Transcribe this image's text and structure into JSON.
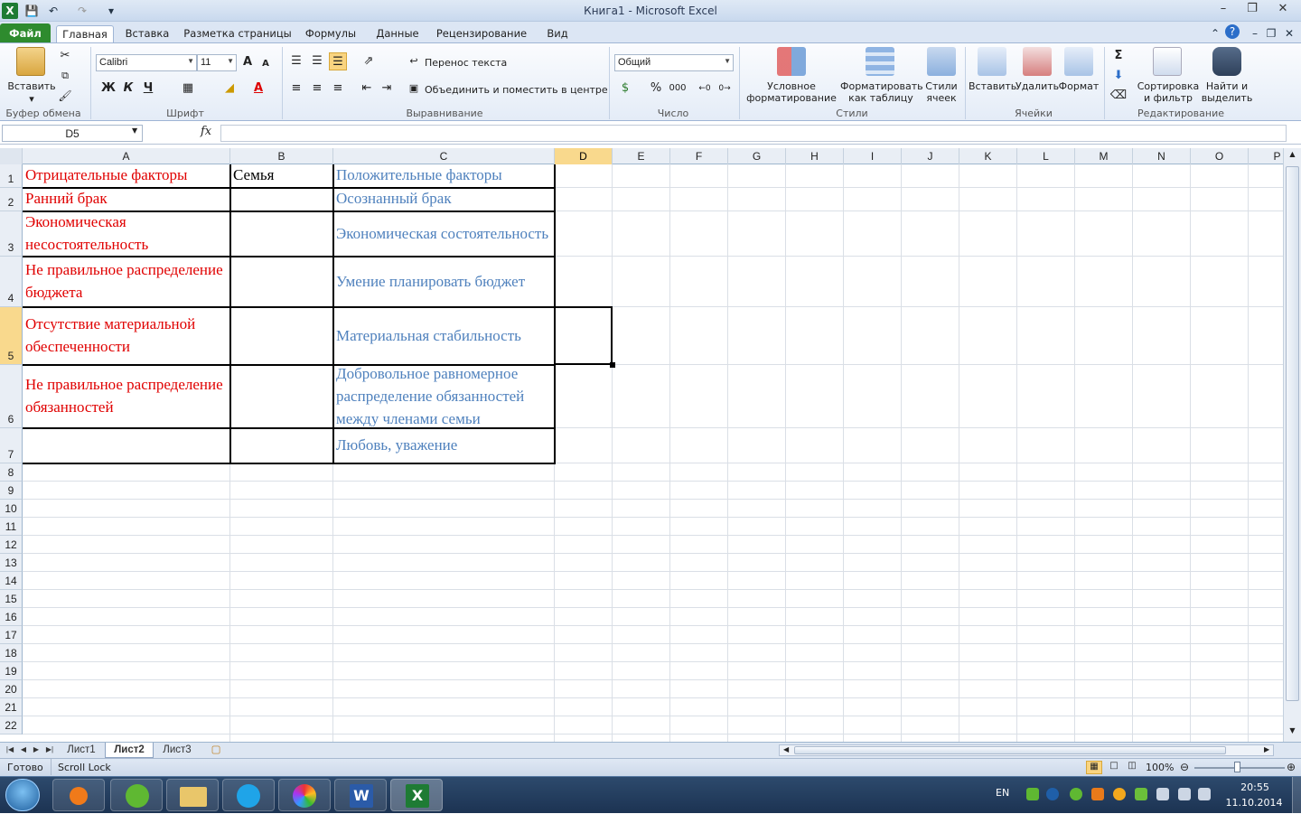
{
  "window": {
    "title": "Книга1  -  Microsoft Excel"
  },
  "ribbon_tabs": [
    "Файл",
    "Главная",
    "Вставка",
    "Разметка страницы",
    "Формулы",
    "Данные",
    "Рецензирование",
    "Вид"
  ],
  "ribbon": {
    "clipboard": {
      "paste": "Вставить",
      "group": "Буфер обмена"
    },
    "font": {
      "name": "Calibri",
      "size": "11",
      "bold": "Ж",
      "italic": "К",
      "underline": "Ч",
      "group": "Шрифт"
    },
    "alignment": {
      "wrap": "Перенос текста",
      "merge": "Объединить и поместить в центре",
      "group": "Выравнивание"
    },
    "number": {
      "format": "Общий",
      "group": "Число"
    },
    "styles": {
      "conditional": "Условное форматирование",
      "as_table": "Форматировать как таблицу",
      "cell_styles": "Стили ячеек",
      "group": "Стили"
    },
    "cells": {
      "insert": "Вставить",
      "delete": "Удалить",
      "format": "Формат",
      "group": "Ячейки"
    },
    "editing": {
      "sort": "Сортировка и фильтр",
      "find": "Найти и выделить",
      "group": "Редактирование"
    }
  },
  "formula_bar": {
    "name_box": "D5",
    "fx": "fx",
    "value": ""
  },
  "columns": [
    "A",
    "B",
    "C",
    "D",
    "E",
    "F",
    "G",
    "H",
    "I",
    "J",
    "K",
    "L",
    "M",
    "N",
    "O",
    "P"
  ],
  "selected_column": "D",
  "selected_row": "5",
  "rows": [
    "1",
    "2",
    "3",
    "4",
    "5",
    "6",
    "7",
    "8",
    "9",
    "10",
    "11",
    "12",
    "13",
    "14",
    "15",
    "16",
    "17",
    "18",
    "19",
    "20",
    "21",
    "22"
  ],
  "cells": {
    "A1": "Отрицательные факторы",
    "B1": "Семья",
    "C1": "Положительные факторы",
    "A2": " Ранний брак",
    "C2": "Осознанный брак",
    "A3": "Экономическая несостоятельность",
    "C3": "Экономическая состоятельность",
    "A4": "Не правильное распределение бюджета",
    "C4": "Умение планировать бюджет",
    "A5": "Отсутствие материальной обеспеченности",
    "C5": "Материальная стабильность",
    "A6": "Не правильное распределение обязанностей",
    "C6": "Добровольное равномерное распределение обязанностей между членами семьи",
    "C7": "Любовь, уважение"
  },
  "sheets": [
    "Лист1",
    "Лист2",
    "Лист3"
  ],
  "active_sheet": "Лист2",
  "status": {
    "ready": "Готово",
    "scroll_lock": "Scroll Lock",
    "zoom": "100%"
  },
  "taskbar": {
    "lang": "EN",
    "time": "20:55",
    "date": "11.10.2014"
  },
  "colors": {
    "negative": "#e00000",
    "positive": "#4f81bd",
    "file_tab": "#2e8b2e",
    "selection_header": "#f9d98d"
  }
}
